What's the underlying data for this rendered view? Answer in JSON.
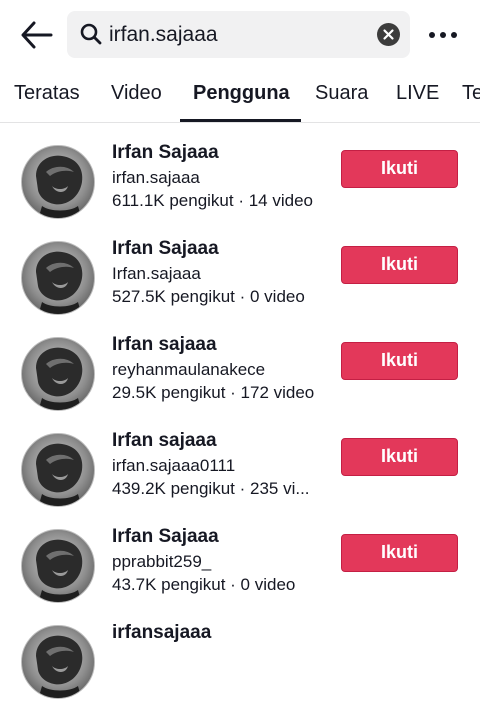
{
  "search": {
    "query": "irfan.sajaaa"
  },
  "tabs": [
    {
      "label": "Teratas"
    },
    {
      "label": "Video"
    },
    {
      "label": "Pengguna"
    },
    {
      "label": "Suara"
    },
    {
      "label": "LIVE"
    },
    {
      "label": "Te"
    }
  ],
  "active_tab": "Pengguna",
  "users": [
    {
      "name": "Irfan Sajaaa",
      "handle": "irfan.sajaaa",
      "stats": "611.1K pengikut · 14 video",
      "button": "Ikuti"
    },
    {
      "name": "Irfan Sajaaa",
      "handle": "Irfan.sajaaa",
      "stats": "527.5K pengikut · 0 video",
      "button": "Ikuti"
    },
    {
      "name": "Irfan sajaaa",
      "handle": "reyhanmaulanakece",
      "stats": "29.5K pengikut · 172 video",
      "button": "Ikuti"
    },
    {
      "name": "Irfan sajaaa",
      "handle": "irfan.sajaaa0111",
      "stats": "439.2K pengikut · 235 vi...",
      "button": "Ikuti"
    },
    {
      "name": "Irfan Sajaaa",
      "handle": "pprabbit259_",
      "stats": "43.7K pengikut · 0 video",
      "button": "Ikuti"
    },
    {
      "name": "irfansajaaa",
      "handle": "",
      "stats": "",
      "button": ""
    }
  ],
  "colors": {
    "follow_button": "#e3385a",
    "text": "#161823",
    "search_bg": "#f1f1f2"
  },
  "icons": [
    "back-arrow-icon",
    "search-icon",
    "clear-icon",
    "more-icon"
  ]
}
